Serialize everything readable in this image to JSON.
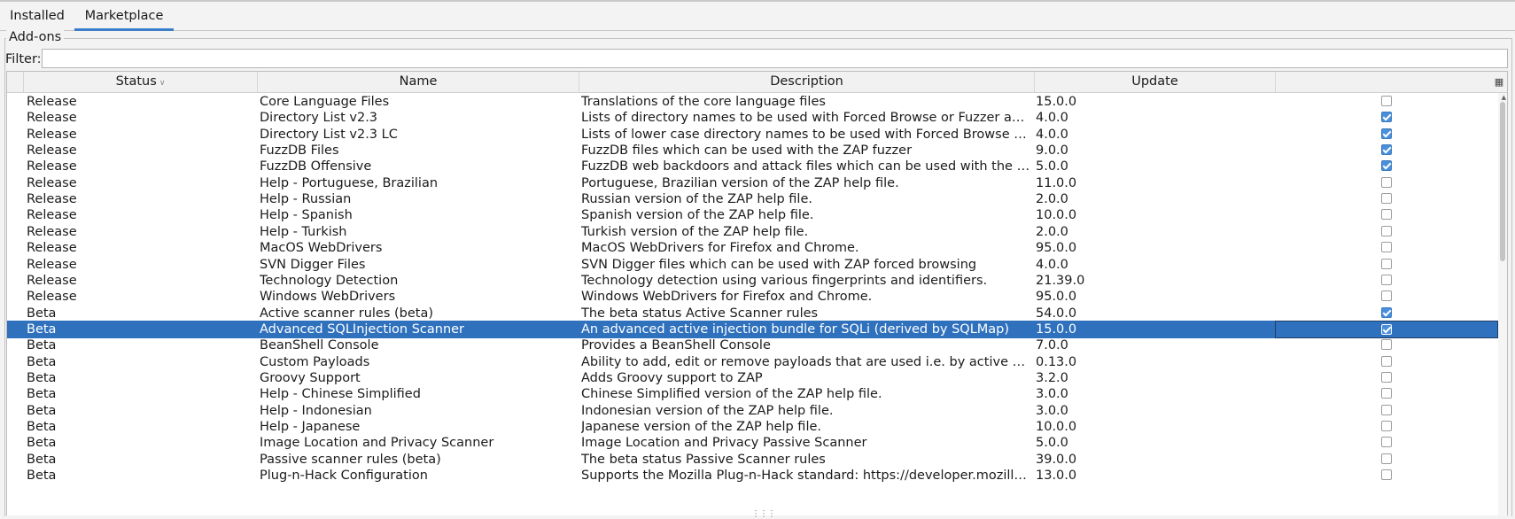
{
  "tabs": [
    {
      "label": "Installed",
      "active": false
    },
    {
      "label": "Marketplace",
      "active": true
    }
  ],
  "group_title": "Add-ons",
  "filter": {
    "label": "Filter:",
    "value": ""
  },
  "columns": {
    "status": "Status",
    "name": "Name",
    "description": "Description",
    "update": "Update"
  },
  "colors": {
    "selection": "#2f71bd",
    "accent": "#3a7ecb",
    "checkbox": "#4a8fdc"
  },
  "rows": [
    {
      "status": "Release",
      "name": "Core Language Files",
      "description": "Translations of the core language files",
      "update": "15.0.0",
      "checked": false,
      "selected": false
    },
    {
      "status": "Release",
      "name": "Directory List v2.3",
      "description": "Lists of directory names to be used with Forced Browse or Fuzzer add-on.",
      "update": "4.0.0",
      "checked": true,
      "selected": false
    },
    {
      "status": "Release",
      "name": "Directory List v2.3 LC",
      "description": "Lists of lower case directory names to be used with Forced Browse or Fuzzer add-on.",
      "update": "4.0.0",
      "checked": true,
      "selected": false
    },
    {
      "status": "Release",
      "name": "FuzzDB Files",
      "description": "FuzzDB files which can be used with the ZAP fuzzer",
      "update": "9.0.0",
      "checked": true,
      "selected": false
    },
    {
      "status": "Release",
      "name": "FuzzDB Offensive",
      "description": "FuzzDB web backdoors and attack files which can be used with the ZAP fuzzer",
      "update": "5.0.0",
      "checked": true,
      "selected": false
    },
    {
      "status": "Release",
      "name": "Help - Portuguese, Brazilian",
      "description": "Portuguese, Brazilian version of the ZAP help file.",
      "update": "11.0.0",
      "checked": false,
      "selected": false
    },
    {
      "status": "Release",
      "name": "Help - Russian",
      "description": "Russian version of the ZAP help file.",
      "update": "2.0.0",
      "checked": false,
      "selected": false
    },
    {
      "status": "Release",
      "name": "Help - Spanish",
      "description": "Spanish version of the ZAP help file.",
      "update": "10.0.0",
      "checked": false,
      "selected": false
    },
    {
      "status": "Release",
      "name": "Help - Turkish",
      "description": "Turkish version of the ZAP help file.",
      "update": "2.0.0",
      "checked": false,
      "selected": false
    },
    {
      "status": "Release",
      "name": "MacOS WebDrivers",
      "description": "MacOS WebDrivers for Firefox and Chrome.",
      "update": "95.0.0",
      "checked": false,
      "selected": false
    },
    {
      "status": "Release",
      "name": "SVN Digger Files",
      "description": "SVN Digger files which can be used with ZAP forced browsing",
      "update": "4.0.0",
      "checked": false,
      "selected": false
    },
    {
      "status": "Release",
      "name": "Technology Detection",
      "description": "Technology detection using various fingerprints and identifiers.",
      "update": "21.39.0",
      "checked": false,
      "selected": false
    },
    {
      "status": "Release",
      "name": "Windows WebDrivers",
      "description": "Windows WebDrivers for Firefox and Chrome.",
      "update": "95.0.0",
      "checked": false,
      "selected": false
    },
    {
      "status": "Beta",
      "name": "Active scanner rules (beta)",
      "description": "The beta status Active Scanner rules",
      "update": "54.0.0",
      "checked": true,
      "selected": false
    },
    {
      "status": "Beta",
      "name": "Advanced SQLInjection Scanner",
      "description": "An advanced active injection bundle for SQLi (derived by SQLMap)",
      "update": "15.0.0",
      "checked": true,
      "selected": true
    },
    {
      "status": "Beta",
      "name": "BeanShell Console",
      "description": "Provides a BeanShell Console",
      "update": "7.0.0",
      "checked": false,
      "selected": false
    },
    {
      "status": "Beta",
      "name": "Custom Payloads",
      "description": "Ability to add, edit or remove payloads that are used i.e. by active scanners",
      "update": "0.13.0",
      "checked": false,
      "selected": false
    },
    {
      "status": "Beta",
      "name": "Groovy Support",
      "description": "Adds Groovy support to ZAP",
      "update": "3.2.0",
      "checked": false,
      "selected": false
    },
    {
      "status": "Beta",
      "name": "Help - Chinese Simplified",
      "description": "Chinese Simplified version of the ZAP help file.",
      "update": "3.0.0",
      "checked": false,
      "selected": false
    },
    {
      "status": "Beta",
      "name": "Help - Indonesian",
      "description": "Indonesian version of the ZAP help file.",
      "update": "3.0.0",
      "checked": false,
      "selected": false
    },
    {
      "status": "Beta",
      "name": "Help - Japanese",
      "description": "Japanese version of the ZAP help file.",
      "update": "10.0.0",
      "checked": false,
      "selected": false
    },
    {
      "status": "Beta",
      "name": "Image Location and Privacy Scanner",
      "description": "Image Location and Privacy Passive Scanner",
      "update": "5.0.0",
      "checked": false,
      "selected": false
    },
    {
      "status": "Beta",
      "name": "Passive scanner rules (beta)",
      "description": "The beta status Passive Scanner rules",
      "update": "39.0.0",
      "checked": false,
      "selected": false
    },
    {
      "status": "Beta",
      "name": "Plug-n-Hack Configuration",
      "description": "Supports the Mozilla Plug-n-Hack standard: https://developer.mozilla.org/",
      "update": "13.0.0",
      "checked": false,
      "selected": false
    }
  ]
}
